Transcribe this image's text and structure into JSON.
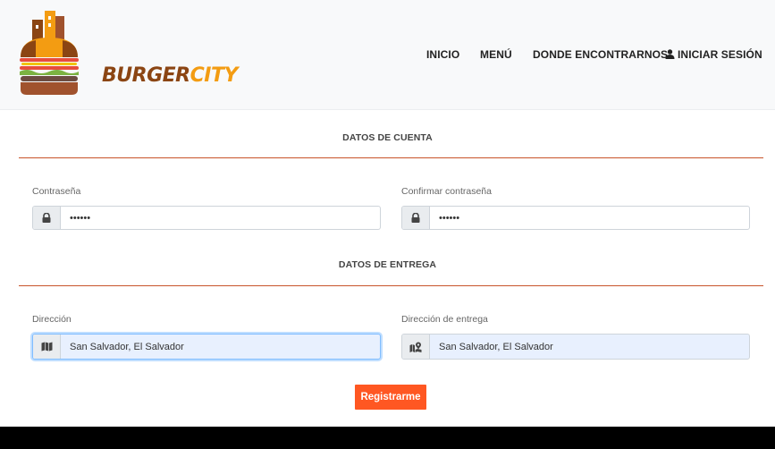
{
  "header": {
    "brand_part1": "BURGER",
    "brand_part2": "CITY",
    "nav": {
      "inicio": "INICIO",
      "menu": "MENÚ",
      "donde": "DONDE ENCONTRARNOS",
      "login": "INICIAR SESIÓN"
    }
  },
  "account": {
    "title": "DATOS DE CUENTA",
    "password_label": "Contraseña",
    "password_value": "••••••",
    "confirm_label": "Confirmar contraseña",
    "confirm_value": "••••••"
  },
  "delivery": {
    "title": "DATOS DE ENTREGA",
    "address_label": "Dirección",
    "address_value": "San Salvador, El Salvador",
    "delivery_label": "Dirección de entrega",
    "delivery_value": "San Salvador, El Salvador"
  },
  "submit_label": "Registrarme",
  "icons": {
    "user": "user-icon",
    "lock": "lock-icon",
    "map": "map-icon",
    "map_marker": "map-marker-icon"
  },
  "colors": {
    "accent": "#ff5722",
    "rule": "#c8542a",
    "brand_brown": "#8b4513",
    "brand_orange": "#f39c12"
  }
}
